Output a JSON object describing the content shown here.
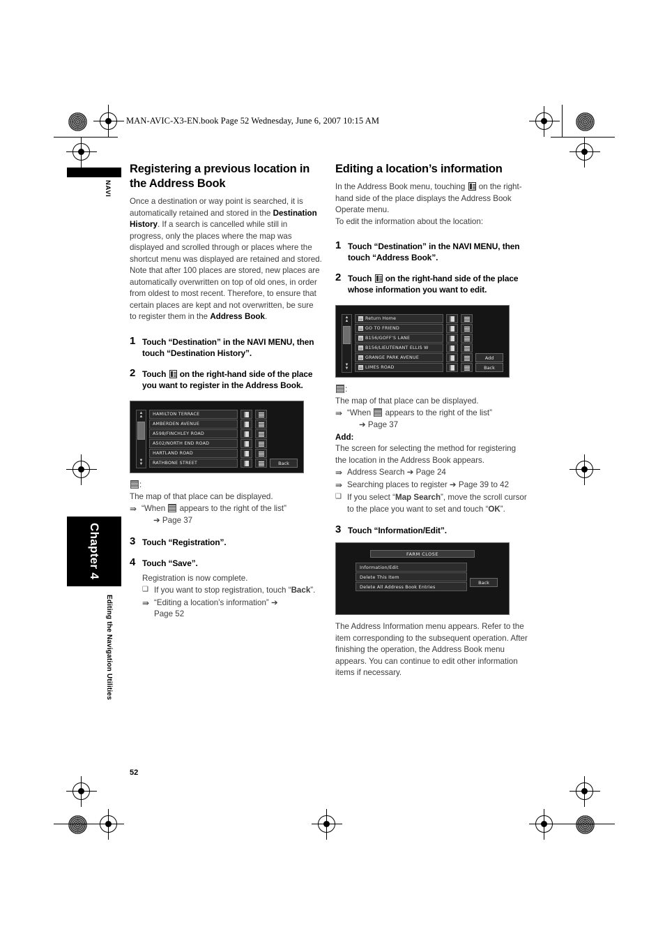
{
  "running_head": "MAN-AVIC-X3-EN.book  Page 52  Wednesday, June 6, 2007  10:15 AM",
  "page_number": "52",
  "sidebar": {
    "navi_label": "NAVI",
    "chapter_label": "Chapter 4",
    "chapter_subtitle": "Editing the Navigation Utilities"
  },
  "left_column": {
    "heading": "Registering a previous location in the Address Book",
    "intro_a": "Once a destination or way point is searched, it is automatically retained and stored in the ",
    "intro_b": "Destination History",
    "intro_c": ". If a search is cancelled while still in progress, only the places where the map was displayed and scrolled through or places where the shortcut menu was displayed are retained and stored. Note that after 100 places are stored, new places are automatically overwritten on top of old ones, in order from oldest to most recent. Therefore, to ensure that certain places are kept and not overwritten, be sure to register them in the ",
    "intro_d": "Address Book",
    "intro_e": ".",
    "steps": [
      {
        "num": "1",
        "text_a": "Touch “Destination” in the ",
        "text_b": "NAVI MENU",
        "text_c": ", then touch “Destination History”."
      },
      {
        "num": "2",
        "text_a": "Touch ",
        "text_b": " on the right-hand side of the place you want to register in the Address Book."
      },
      {
        "num": "3",
        "text_a": "Touch “Registration”."
      },
      {
        "num": "4",
        "text_a": "Touch “Save”."
      }
    ],
    "map_icon_caption": ":",
    "map_icon_desc": "The map of that place can be displayed.",
    "ref_when_a": "“When ",
    "ref_when_b": " appears to the right of the list”",
    "ref_when_page": "➔ Page 37",
    "registration_done": "Registration is now complete.",
    "note_stop_a": "If you want to stop registration, touch “",
    "note_stop_b": "Back",
    "note_stop_c": "”.",
    "ref_editing_a": "“Editing a location’s information” ➔",
    "ref_editing_b": "Page 52",
    "screen": {
      "rows": [
        {
          "name": "HAMILTON TERRACE"
        },
        {
          "name": "AMBERDEN AVENUE"
        },
        {
          "name": "A598/FINCHLEY ROAD"
        },
        {
          "name": "A502/NORTH END ROAD"
        },
        {
          "name": "HARTLAND ROAD"
        },
        {
          "name": "RATHBONE STREET"
        }
      ],
      "back_label": "Back"
    }
  },
  "right_column": {
    "heading": "Editing a location’s information",
    "intro_a": "In the Address Book menu, touching ",
    "intro_b": " on the right-hand side of the place displays the Address Book Operate menu.",
    "intro_c": "To edit the information about the location:",
    "steps": [
      {
        "num": "1",
        "text_a": "Touch “Destination” in the ",
        "text_b": "NAVI MENU",
        "text_c": ", then touch “Address Book”."
      },
      {
        "num": "2",
        "text_a": "Touch ",
        "text_b": " on the right-hand side of the place whose information you want to edit."
      },
      {
        "num": "3",
        "text_a": "Touch “Information/Edit”."
      }
    ],
    "map_icon_caption": ":",
    "map_icon_desc": "The map of that place can be displayed.",
    "ref_when_a": "“When ",
    "ref_when_b": " appears to the right of the list”",
    "ref_when_page": "➔ Page 37",
    "add_heading": "Add:",
    "add_desc": "The screen for selecting the method for registering the location in the Address Book appears.",
    "ref_address_search": "Address Search ➔ Page 24",
    "ref_searching_places": "Searching places to register ➔ Page 39 to 42",
    "note_map_a": "If you select “",
    "note_map_b": "Map Search",
    "note_map_c": "”, move the scroll cursor to the place you want to set and touch “",
    "note_map_d": "OK",
    "note_map_e": "”.",
    "final_para": "The Address Information menu appears. Refer to the item corresponding to the subsequent operation. After finishing the operation, the Address Book menu appears. You can continue to edit other information items if necessary.",
    "screen_list": {
      "rows": [
        {
          "name": "Return Home"
        },
        {
          "name": "GO TO FRIEND"
        },
        {
          "name": "B156/GOFF’S LANE"
        },
        {
          "name": "B156/LIEUTENANT ELLIS W"
        },
        {
          "name": "GRANGE PARK AVENUE"
        },
        {
          "name": "LIMES ROAD"
        }
      ],
      "add_label": "Add",
      "back_label": "Back"
    },
    "screen_menu": {
      "title": "FARM CLOSE",
      "items": [
        "Information/Edit",
        "Delete This Item",
        "Delete All Address Book Entries"
      ],
      "back_label": "Back"
    }
  }
}
